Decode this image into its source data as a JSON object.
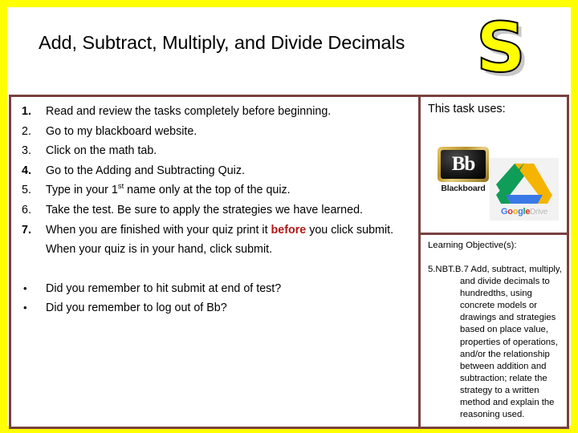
{
  "slide": {
    "border_color": "#ffff00",
    "table_border_color": "#7a4040",
    "accent_red": "#b01818"
  },
  "header": {
    "title": "Add, Subtract, Multiply, and Divide Decimals",
    "logo_letter": "S"
  },
  "tasks": {
    "items": [
      {
        "number": "1.",
        "text": "Read and review the tasks completely before beginning.",
        "bold_marker": true
      },
      {
        "number": "2.",
        "text": "Go to my blackboard website.",
        "bold_marker": false
      },
      {
        "number": "3.",
        "text": "Click on the math tab.",
        "bold_marker": false
      },
      {
        "number": "4.",
        "text": "Go to the Adding and Subtracting Quiz.",
        "bold_marker": true
      },
      {
        "number": "5.",
        "text_before_sup": "Type in your 1",
        "superscript": "st",
        "text_after_sup": " name only at the top of the quiz.",
        "bold_marker": false
      },
      {
        "number": "6.",
        "text": "Take the test.  Be sure to apply the strategies we have learned.",
        "bold_marker": false
      },
      {
        "number": "7.",
        "text_part1": "When you are finished with your quiz print it ",
        "highlight": "before",
        "text_part2": " you click submit.  When your quiz is in your hand, click submit.",
        "bold_marker": true
      }
    ]
  },
  "reminders": {
    "bullet": "•",
    "items": [
      "Did you remember to hit submit at end of test?",
      "Did you remember to log out of Bb?"
    ]
  },
  "uses": {
    "title": "This task uses:",
    "blackboard": {
      "mark": "Bb",
      "caption": "Blackboard"
    },
    "google_drive": {
      "caption_g": "G",
      "caption_o1": "o",
      "caption_o2": "o",
      "caption_g2": "g",
      "caption_l": "l",
      "caption_e": "e",
      "caption_drive": "Drive",
      "colors": {
        "green": "#0f9d58",
        "yellow": "#f4b400",
        "blue": "#3b78e7"
      }
    }
  },
  "objectives": {
    "title": "Learning Objective(s):",
    "code": "5.NBT.B.7",
    "text": "5.NBT.B.7 Add, subtract, multiply, and divide decimals to hundredths, using concrete models or drawings and strategies based on place value, properties of operations, and/or the relationship between addition and subtraction; relate the strategy to a written method and explain the reasoning used."
  }
}
